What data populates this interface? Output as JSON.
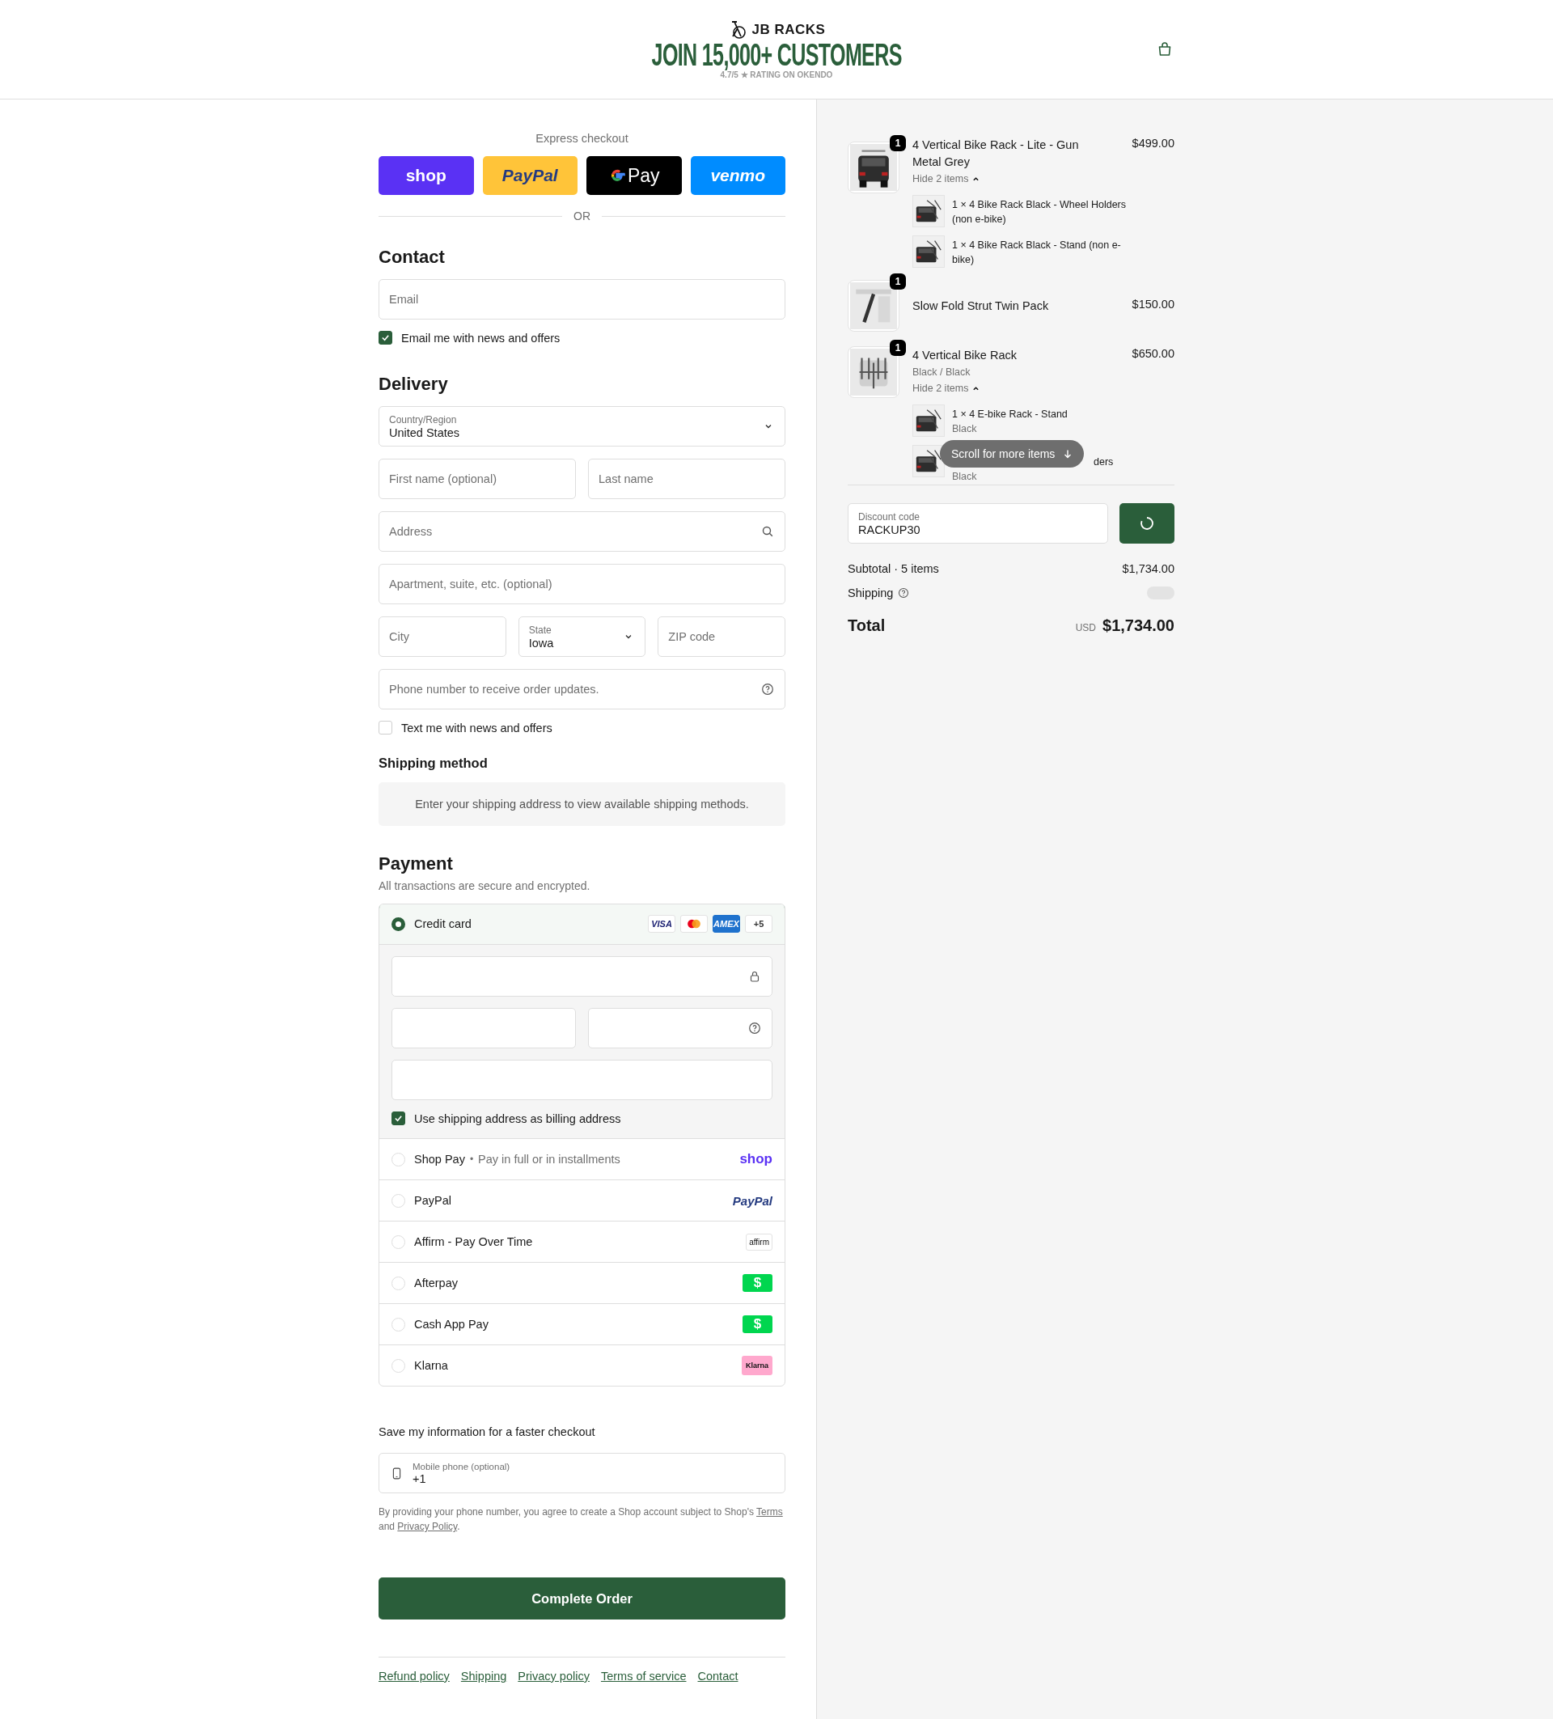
{
  "header": {
    "brand": "JB RACKS",
    "headline": "JOIN 15,000+ CUSTOMERS",
    "rating": "4.7/5 ★ RATING ON OKENDO"
  },
  "express_checkout": {
    "title": "Express checkout",
    "separator": "OR",
    "buttons": [
      {
        "kind": "shop",
        "label": "shop"
      },
      {
        "kind": "paypal",
        "label": "PayPal"
      },
      {
        "kind": "gpay",
        "label": "Pay"
      },
      {
        "kind": "venmo",
        "label": "venmo"
      }
    ]
  },
  "contact": {
    "heading": "Contact",
    "email": {
      "placeholder": "Email"
    },
    "news_checkbox": {
      "label": "Email me with news and offers",
      "checked": true
    }
  },
  "delivery": {
    "heading": "Delivery",
    "country": {
      "label": "Country/Region",
      "value": "United States"
    },
    "first_name": {
      "placeholder": "First name (optional)"
    },
    "last_name": {
      "placeholder": "Last name"
    },
    "address": {
      "placeholder": "Address"
    },
    "apartment": {
      "placeholder": "Apartment, suite, etc. (optional)"
    },
    "city": {
      "placeholder": "City"
    },
    "state": {
      "label": "State",
      "value": "Iowa"
    },
    "zip": {
      "placeholder": "ZIP code"
    },
    "phone": {
      "placeholder": "Phone number to receive order updates."
    },
    "text_checkbox": {
      "label": "Text me with news and offers",
      "checked": false
    }
  },
  "shipping_method": {
    "heading": "Shipping method",
    "message": "Enter your shipping address to view available shipping methods."
  },
  "payment": {
    "heading": "Payment",
    "subtitle": "All transactions are secure and encrypted.",
    "billing_checkbox": {
      "label": "Use shipping address as billing address",
      "checked": true
    },
    "methods": [
      {
        "kind": "card",
        "label": "Credit card",
        "selected": true,
        "card_brands": [
          {
            "kind": "visa",
            "label": "VISA"
          },
          {
            "kind": "mastercard"
          },
          {
            "kind": "amex",
            "label": "AMEX"
          },
          {
            "kind": "more",
            "label": "+5"
          }
        ]
      },
      {
        "kind": "shop_pay",
        "label": "Shop Pay",
        "note_separator": "•",
        "note": "Pay in full or in installments",
        "logo": "shop",
        "selected": false
      },
      {
        "kind": "paypal",
        "label": "PayPal",
        "logo": "PayPal",
        "selected": false
      },
      {
        "kind": "affirm",
        "label": "Affirm - Pay Over Time",
        "logo": "affirm",
        "selected": false
      },
      {
        "kind": "afterpay",
        "label": "Afterpay",
        "logo": "$",
        "selected": false
      },
      {
        "kind": "cashapp",
        "label": "Cash App Pay",
        "logo": "$",
        "selected": false
      },
      {
        "kind": "klarna",
        "label": "Klarna",
        "logo": "Klarna",
        "selected": false
      }
    ]
  },
  "save_info": {
    "heading": "Save my information for a faster checkout",
    "mobile": {
      "label": "Mobile phone (optional)",
      "value": "+1"
    },
    "legal": {
      "text": "By providing your phone number, you agree to create a Shop account subject to Shop's",
      "terms_link": "Terms",
      "middle": "and",
      "privacy_link": "Privacy Policy",
      "end": "."
    }
  },
  "complete_button": "Complete Order",
  "footer_links": [
    "Refund policy",
    "Shipping",
    "Privacy policy",
    "Terms of service",
    "Contact"
  ],
  "order_summary": {
    "items": [
      {
        "name": "4 Vertical Bike Rack - Lite - Gun Metal Grey",
        "quantity": "1",
        "price": "$499.00",
        "toggle": "Hide 2 items",
        "expanded": true,
        "components": [
          {
            "name": "1 × 4 Bike Rack Black - Wheel Holders (non e-bike)"
          },
          {
            "name": "1 × 4 Bike Rack Black - Stand (non e-bike)"
          }
        ]
      },
      {
        "name": "Slow Fold Strut Twin Pack",
        "quantity": "1",
        "price": "$150.00"
      },
      {
        "name": "4 Vertical Bike Rack",
        "quantity": "1",
        "variant": "Black / Black",
        "price": "$650.00",
        "toggle": "Hide 2 items",
        "expanded": true,
        "components": [
          {
            "name": "1 × 4 E-bike Rack - Stand",
            "variant": "Black"
          },
          {
            "name": "ders",
            "variant": "Black",
            "covered": true
          }
        ]
      }
    ],
    "scroll_hint": "Scroll for more items",
    "discount": {
      "label": "Discount code",
      "value": "RACKUP30"
    },
    "subtotal": {
      "label": "Subtotal · 5 items",
      "value": "$1,734.00"
    },
    "shipping": {
      "label": "Shipping"
    },
    "total": {
      "label": "Total",
      "currency": "USD",
      "value": "$1,734.00"
    }
  }
}
